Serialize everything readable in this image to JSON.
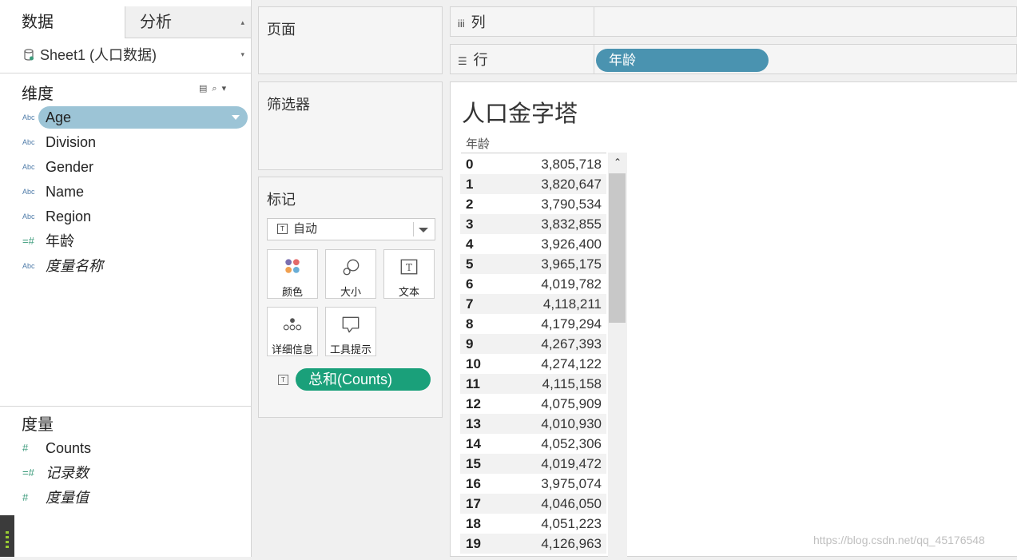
{
  "data_pane": {
    "tab_data": "数据",
    "tab_analysis": "分析",
    "datasource": "Sheet1 (人口数据)",
    "dimensions_title": "维度",
    "dimensions": [
      {
        "type": "Abc",
        "name": "Age"
      },
      {
        "type": "Abc",
        "name": "Division"
      },
      {
        "type": "Abc",
        "name": "Gender"
      },
      {
        "type": "Abc",
        "name": "Name"
      },
      {
        "type": "Abc",
        "name": "Region"
      },
      {
        "type": "=#",
        "name": "年龄"
      },
      {
        "type": "Abc",
        "name": "度量名称"
      }
    ],
    "measures_title": "度量",
    "measures": [
      {
        "type": "#",
        "name": "Counts"
      },
      {
        "type": "=#",
        "name": "记录数"
      },
      {
        "type": "#",
        "name": "度量值"
      }
    ]
  },
  "cards": {
    "pages": "页面",
    "filters": "筛选器",
    "marks": "标记",
    "mark_type": "自动",
    "mark_buttons": [
      "颜色",
      "大小",
      "文本",
      "详细信息",
      "工具提示"
    ],
    "text_pill": "总和(Counts)"
  },
  "shelves": {
    "columns_label": "列",
    "rows_label": "行",
    "rows_pill": "年龄"
  },
  "view": {
    "title": "人口金字塔",
    "column_header": "年龄",
    "rows": [
      {
        "age": "0",
        "value": "3,805,718"
      },
      {
        "age": "1",
        "value": "3,820,647"
      },
      {
        "age": "2",
        "value": "3,790,534"
      },
      {
        "age": "3",
        "value": "3,832,855"
      },
      {
        "age": "4",
        "value": "3,926,400"
      },
      {
        "age": "5",
        "value": "3,965,175"
      },
      {
        "age": "6",
        "value": "4,019,782"
      },
      {
        "age": "7",
        "value": "4,118,211"
      },
      {
        "age": "8",
        "value": "4,179,294"
      },
      {
        "age": "9",
        "value": "4,267,393"
      },
      {
        "age": "10",
        "value": "4,274,122"
      },
      {
        "age": "11",
        "value": "4,115,158"
      },
      {
        "age": "12",
        "value": "4,075,909"
      },
      {
        "age": "13",
        "value": "4,010,930"
      },
      {
        "age": "14",
        "value": "4,052,306"
      },
      {
        "age": "15",
        "value": "4,019,472"
      },
      {
        "age": "16",
        "value": "3,975,074"
      },
      {
        "age": "17",
        "value": "4,046,050"
      },
      {
        "age": "18",
        "value": "4,051,223"
      },
      {
        "age": "19",
        "value": "4,126,963"
      }
    ]
  },
  "watermark": "https://blog.csdn.net/qq_45176548",
  "colors": {
    "age_pill": "#9cc4d6",
    "rows_pill": "#4a93b0",
    "measure_pill": "#1aa07a"
  }
}
